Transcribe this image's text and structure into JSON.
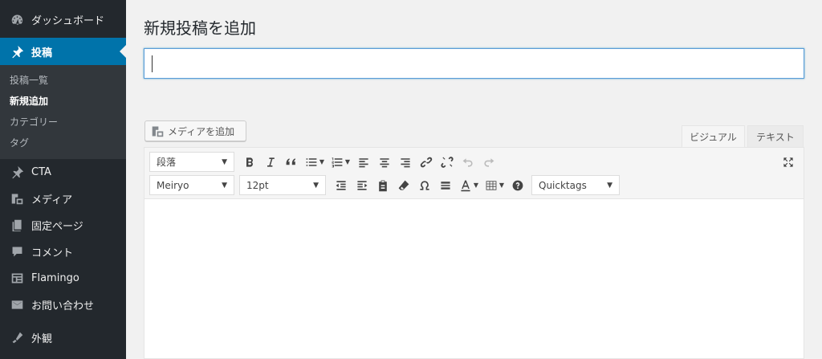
{
  "sidebar": {
    "items": [
      {
        "label": "ダッシュボード",
        "icon": "dashboard-icon"
      },
      {
        "label": "投稿",
        "icon": "pin-icon",
        "current": true
      },
      {
        "label": "CTA",
        "icon": "pin-icon"
      },
      {
        "label": "メディア",
        "icon": "media-icon"
      },
      {
        "label": "固定ページ",
        "icon": "page-icon"
      },
      {
        "label": "コメント",
        "icon": "comment-icon"
      },
      {
        "label": "Flamingo",
        "icon": "flamingo-icon"
      },
      {
        "label": "お問い合わせ",
        "icon": "mail-icon"
      },
      {
        "label": "外観",
        "icon": "appearance-icon"
      }
    ],
    "submenu": [
      {
        "label": "投稿一覧"
      },
      {
        "label": "新規追加",
        "current": true
      },
      {
        "label": "カテゴリー"
      },
      {
        "label": "タグ"
      }
    ]
  },
  "page": {
    "title": "新規投稿を追加"
  },
  "title_input": {
    "value": "",
    "placeholder": ""
  },
  "media_button": {
    "label": "メディアを追加"
  },
  "tabs": {
    "visual": "ビジュアル",
    "text": "テキスト"
  },
  "toolbar": {
    "format_select": "段落",
    "font_select": "Meiryo",
    "size_select": "12pt",
    "quicktags_select": "Quicktags"
  },
  "colors": {
    "sidebar": "#23282d",
    "accent": "#0073aa",
    "focus": "#5b9dd9"
  }
}
